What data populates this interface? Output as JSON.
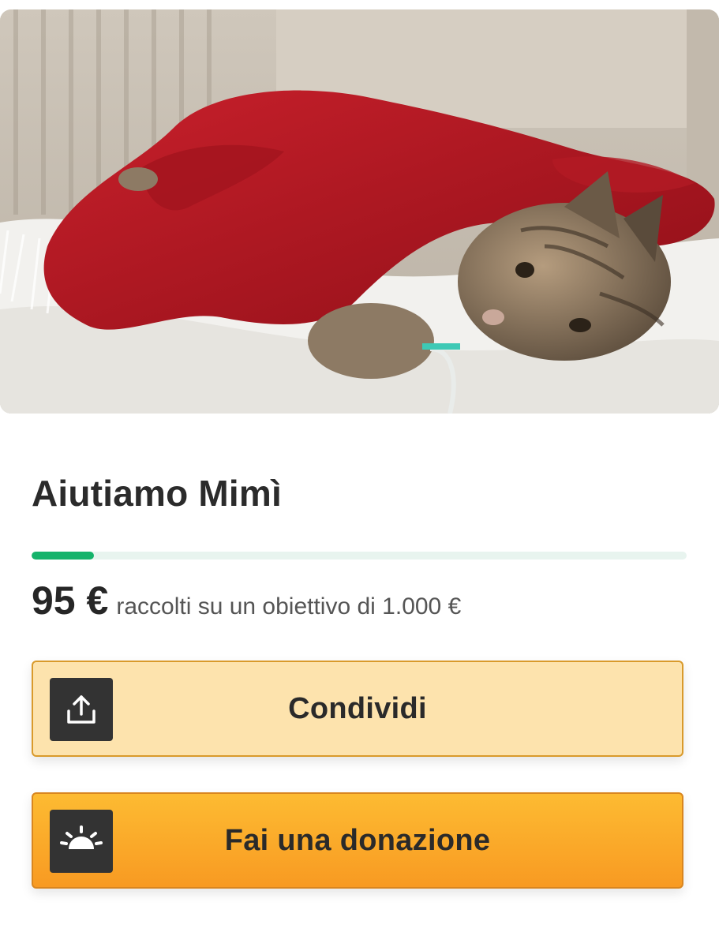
{
  "campaign": {
    "title": "Aiutiamo Mimì",
    "raised_amount": "95 €",
    "goal_text": "raccolti su un obiettivo di 1.000 €",
    "progress_fraction": 0.095
  },
  "buttons": {
    "share_label": "Condividi",
    "donate_label": "Fai una donazione"
  },
  "icons": {
    "share": "share-upload-icon",
    "donate": "donation-hand-icon"
  },
  "colors": {
    "progress_fill": "#15b36b",
    "progress_track": "#e8f4ef",
    "share_button_bg": "#fde3ad",
    "donate_button_bg": "#f9a825"
  }
}
